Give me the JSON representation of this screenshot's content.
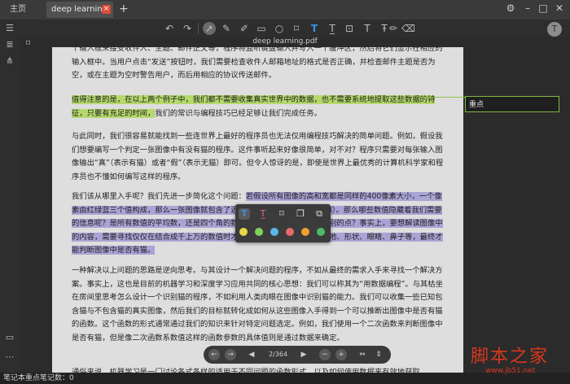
{
  "tabs": {
    "home": "主页",
    "doc": "deep learning"
  },
  "doc_title": "deep learning.pdf",
  "toolbar_icons": [
    "undo-icon",
    "redo-icon",
    "select-icon",
    "pen-icon",
    "marker-icon",
    "rectangle-icon",
    "circle-icon",
    "bookmark-icon",
    "text-highlight-icon",
    "underline-icon",
    "textbox-icon",
    "insert-text-icon",
    "strike-icon",
    "pencil-icon",
    "eraser-icon"
  ],
  "avatar": "T",
  "paragraphs": {
    "p1": "个输入框来接受收件人、主题、邮件正文等，程序将监听键盘输入并写入一个缓冲区，然后将它们显示在相应的输入框中。当用户点击“发送”按钮时，我们需要检查收件人邮箱地址的格式是否正确，并检查邮件主题是否为空，或在主题为空时警告用户，而后用相应的协议传送邮件。",
    "p2_hl": "值得注意的是，在以上两个例子中，我们都不需要收集真实世界中的数据，也不需要系统地提取这些数据的特征，只要有充足的时间，",
    "p2_rest": "我们的常识与编程技巧已经足够让我们完成任务。",
    "p3": "与此同时，我们很容易就能找到一些连世界上最好的程序员也无法仅用编程技巧解决的简单问题。例如，假设我们想要编写一个判定一张图像中有没有猫的程序。这件事听起来好像很简单，对不对？程序只需要对每张输入图像输出“真”（表示有猫）或者“假”（表示无猫）即可。但令人惊讶的是，即使是世界上最优秀的计算机科学家和程序员也不懂如何编写这样的程序。",
    "p4_pre": "我们该从哪里入手呢？我们先进一步简化这个问题：",
    "p4_hl": "若假设所有图像的高和宽都是同样的400像素大小，一个像素由红绿蓝三个值构成，那么一张图像就包含了近50万个数值（400×400×3）。那么哪些数值隐藏着我们需要的信息呢？是所有数值的平均数，还是四个角的数值，或是图像中的某一个特别的点？事实上，要想解读图像中的内容，需要寻找仅仅在结合成千上万的数值时才会出现的特征，如边缘、质地、形状、眼睛、鼻子等，最终才能判断图像中是否有猫。",
    "p5": "一种解决以上问题的思路是逆向思考。与其设计一个解决问题的程序，不如从最终的需求入手来寻找一个解决方案。事实上，这也是目前的机器学习和深度学习应用共同的核心思想：我们可以称其为“用数据编程”。与其枯坐在房间里思考怎么设计一个识别猫的程序，不如利用人类肉眼在图像中识别猫的能力。我们可以收集一些已知包含猫与不包含猫的真实图像，然后我们的目标就转化成如何从这些图像入手得到一个可以推断出图像中是否有猫的函数。这个函数的形式通常通过我们的知识来针对特定问题选定。例如，我们使用一个二次函数来判断图像中是否有猫，但是像二次函数系数值这样的函数参数的具体值则是通过数据来确定。",
    "p6": "通俗来说，机器学习是一门讨论各式各样的适用于不同问题的函数形式，以及如何使用数据来有效地获取"
  },
  "note_label": "重点",
  "popup": {
    "icons": [
      "highlight-text-icon",
      "underline-text-icon",
      "bookmark-icon",
      "copy-icon",
      "copy-alt-icon"
    ],
    "colors": [
      "#e8d84a",
      "#7ed35a",
      "#5ab8e8",
      "#e86a6a",
      "#f0a030",
      "#4fba6a"
    ]
  },
  "page_nav": {
    "page": "2/364"
  },
  "status": "笔记本重点笔记数：0",
  "watermark": {
    "big": "脚本之家",
    "small": "www.jb51.net"
  }
}
